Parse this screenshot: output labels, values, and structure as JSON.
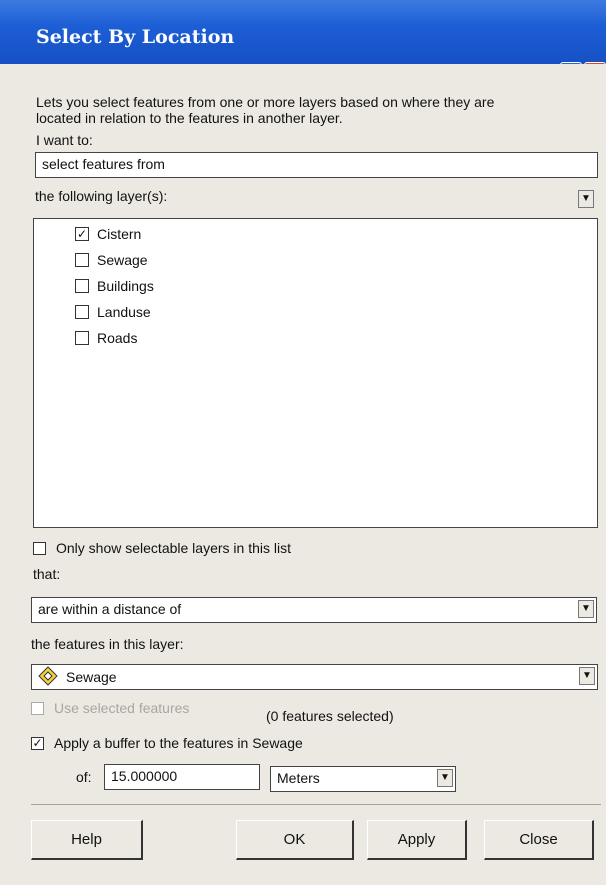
{
  "window": {
    "title": "Select By Location",
    "help_glyph": "?",
    "close_glyph": "×"
  },
  "description": {
    "line1": "Lets you select features from one or more layers based on where they are",
    "line2": "located in relation to the features in another layer."
  },
  "method": {
    "label": "I want to:",
    "value": "select features from"
  },
  "target": {
    "label": "the following layer(s):",
    "layers": [
      {
        "name": "Cistern",
        "checked": true
      },
      {
        "name": "Sewage",
        "checked": false
      },
      {
        "name": "Buildings",
        "checked": false
      },
      {
        "name": "Landuse",
        "checked": false
      },
      {
        "name": "Roads",
        "checked": false
      }
    ],
    "only_selectable_label": "Only show selectable layers in this list"
  },
  "relation": {
    "label": "that:",
    "value": "are within a distance of"
  },
  "source": {
    "label": "the features in this layer:",
    "value": "Sewage",
    "use_selected_label": "Use selected features",
    "selected_count": "(0 features selected)"
  },
  "buffer": {
    "label": "Apply a buffer to the features in Sewage",
    "checked": true,
    "of_label": "of:",
    "distance": "15.000000",
    "units": "Meters"
  },
  "buttons": {
    "help": "Help",
    "ok": "OK",
    "apply": "Apply",
    "close": "Close"
  },
  "icons": {
    "check": "✓",
    "dropdown": "▼",
    "layer_symbol": "diamond-layer-icon"
  }
}
